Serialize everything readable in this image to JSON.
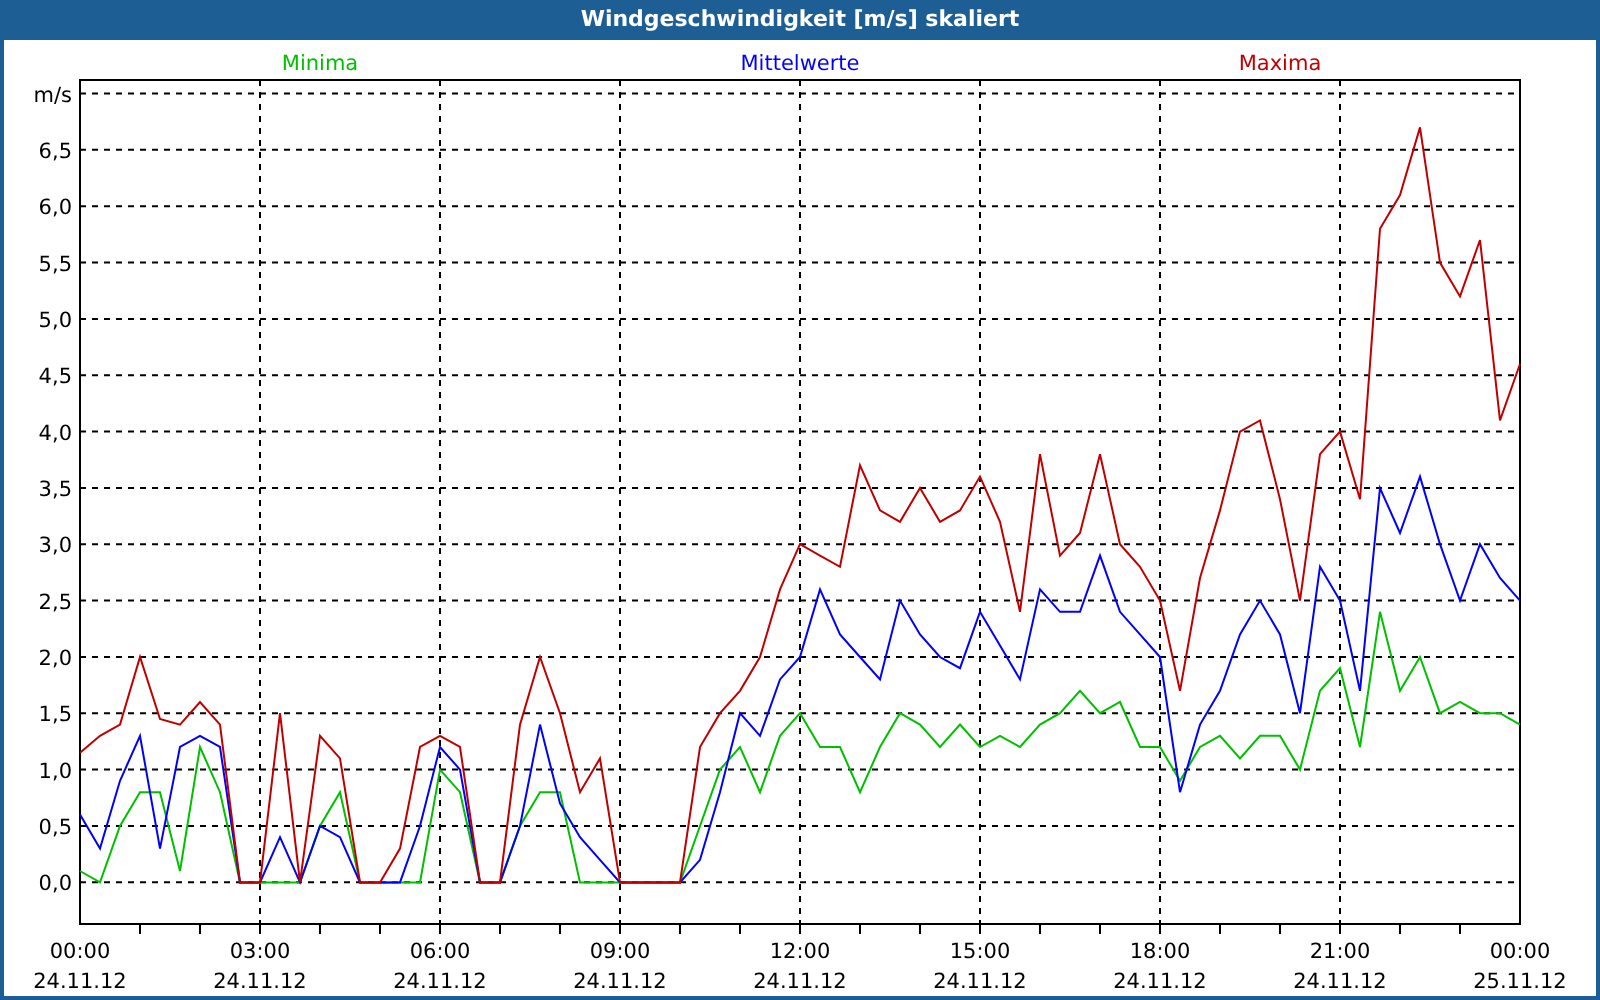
{
  "chart": {
    "chart_data": {
      "type": "line",
      "title": "Windgeschwindigkeit [m/s] skaliert",
      "grid": true,
      "categories": [
        "00:00 24.11.12",
        null,
        null,
        null,
        null,
        null,
        null,
        null,
        null,
        "03:00 24.11.12",
        null,
        null,
        null,
        null,
        null,
        null,
        null,
        null,
        "06:00 24.11.12",
        null,
        null,
        null,
        null,
        null,
        null,
        null,
        null,
        "09:00 24.11.12",
        null,
        null,
        null,
        null,
        null,
        null,
        null,
        null,
        "12:00 24.11.12",
        null,
        null,
        null,
        null,
        null,
        null,
        null,
        null,
        "15:00 24.11.12",
        null,
        null,
        null,
        null,
        null,
        null,
        null,
        null,
        "18:00 24.11.12",
        null,
        null,
        null,
        null,
        null,
        null,
        null,
        null,
        "21:00 24.11.12",
        null,
        null,
        null,
        null,
        null,
        null,
        null,
        null,
        "00:00 25.11.12"
      ],
      "series": [
        {
          "name": "Minima",
          "color": "#00c000",
          "values": [
            0.1,
            0,
            0.5,
            0.8,
            0.8,
            0.1,
            1.2,
            0.8,
            0,
            0,
            0,
            0,
            0.5,
            0.8,
            0,
            0,
            0,
            0,
            1.0,
            0.8,
            0,
            0,
            0.5,
            0.8,
            0.8,
            0,
            0,
            0,
            0,
            0,
            0,
            0.5,
            1.0,
            1.2,
            0.8,
            1.3,
            1.5,
            1.2,
            1.2,
            0.8,
            1.2,
            1.5,
            1.4,
            1.2,
            1.4,
            1.2,
            1.3,
            1.2,
            1.4,
            1.5,
            1.7,
            1.5,
            1.6,
            1.2,
            1.2,
            0.9,
            1.2,
            1.3,
            1.1,
            1.3,
            1.3,
            1.0,
            1.7,
            1.9,
            1.2,
            2.4,
            1.7,
            2.0,
            1.5,
            1.6,
            1.5,
            1.5,
            1.4
          ]
        },
        {
          "name": "Mittelwerte",
          "color": "#0000ff",
          "values": [
            0.6,
            0.3,
            0.9,
            1.3,
            0.3,
            1.2,
            1.3,
            1.2,
            0,
            0,
            0.4,
            0,
            0.5,
            0.4,
            0,
            0,
            0,
            0.5,
            1.2,
            1.0,
            0,
            0,
            0.5,
            1.4,
            0.7,
            0.4,
            0.2,
            0,
            0,
            0,
            0,
            0.2,
            0.8,
            1.5,
            1.3,
            1.8,
            2.0,
            2.6,
            2.2,
            2.0,
            1.8,
            2.5,
            2.2,
            2.0,
            1.9,
            2.4,
            2.1,
            1.8,
            2.6,
            2.4,
            2.4,
            2.9,
            2.4,
            2.2,
            2.0,
            0.8,
            1.4,
            1.7,
            2.2,
            2.5,
            2.2,
            1.5,
            2.8,
            2.5,
            1.7,
            3.5,
            3.1,
            3.6,
            3.0,
            2.5,
            3.0,
            2.7,
            2.5
          ]
        },
        {
          "name": "Maxima",
          "color": "#c00000",
          "values": [
            1.15,
            1.3,
            1.4,
            2.0,
            1.45,
            1.4,
            1.6,
            1.4,
            0,
            0,
            1.5,
            0,
            1.3,
            1.1,
            0,
            0,
            0.3,
            1.2,
            1.3,
            1.2,
            0,
            0,
            1.4,
            2.0,
            1.5,
            0.8,
            1.1,
            0,
            0,
            0,
            0,
            1.2,
            1.5,
            1.7,
            2.0,
            2.6,
            3.0,
            2.9,
            2.8,
            3.7,
            3.3,
            3.2,
            3.5,
            3.2,
            3.3,
            3.6,
            3.2,
            2.4,
            3.8,
            2.9,
            3.1,
            3.8,
            3.0,
            2.8,
            2.5,
            1.7,
            2.7,
            3.3,
            4.0,
            4.1,
            3.4,
            2.5,
            3.8,
            4.0,
            3.4,
            5.8,
            6.1,
            6.7,
            5.5,
            5.2,
            5.7,
            4.1,
            4.6
          ]
        }
      ],
      "ylim": [
        -0.37,
        7.12
      ],
      "yticks": [
        {
          "value": 0,
          "label": "0,0"
        },
        {
          "value": 0.5,
          "label": "0,5"
        },
        {
          "value": 1,
          "label": "1,0"
        },
        {
          "value": 1.5,
          "label": "1,5"
        },
        {
          "value": 2,
          "label": "2,0"
        },
        {
          "value": 2.5,
          "label": "2,5"
        },
        {
          "value": 3,
          "label": "3,0"
        },
        {
          "value": 3.5,
          "label": "3,5"
        },
        {
          "value": 4,
          "label": "4,0"
        },
        {
          "value": 4.5,
          "label": "4,5"
        },
        {
          "value": 5,
          "label": "5,0"
        },
        {
          "value": 5.5,
          "label": "5,5"
        },
        {
          "value": 6,
          "label": "6,0"
        },
        {
          "value": 6.5,
          "label": "6,5"
        },
        {
          "value": 7,
          "label": "m/s"
        }
      ]
    }
  }
}
